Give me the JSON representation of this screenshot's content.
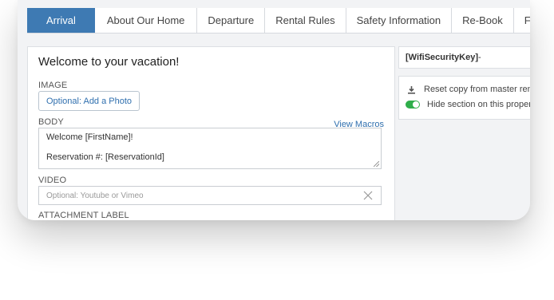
{
  "tabs": [
    {
      "label": "Arrival",
      "active": true
    },
    {
      "label": "About Our Home"
    },
    {
      "label": "Departure"
    },
    {
      "label": "Rental Rules"
    },
    {
      "label": "Safety Information"
    },
    {
      "label": "Re-Book"
    },
    {
      "label": "Fe"
    }
  ],
  "editor": {
    "title": "Welcome to your vacation!",
    "image_label": "IMAGE",
    "add_photo": "Optional: Add a Photo",
    "body_label": "BODY",
    "view_macros": "View Macros",
    "body_line1": "Welcome [FirstName]!",
    "body_line2": "Reservation #: [ReservationId]",
    "video_label": "VIDEO",
    "video_placeholder": "Optional: Youtube or Vimeo",
    "attachment_label": "ATTACHMENT LABEL"
  },
  "side": {
    "key_name": "[WifiSecurityKey]",
    "key_suffix": " -",
    "reset_label": "Reset copy from master rent",
    "hide_label": "Hide section on this propert",
    "hide_enabled": true
  },
  "colors": {
    "active_tab": "#3e7ab3",
    "link": "#2f6fae",
    "toggle_on": "#2fae4a"
  }
}
